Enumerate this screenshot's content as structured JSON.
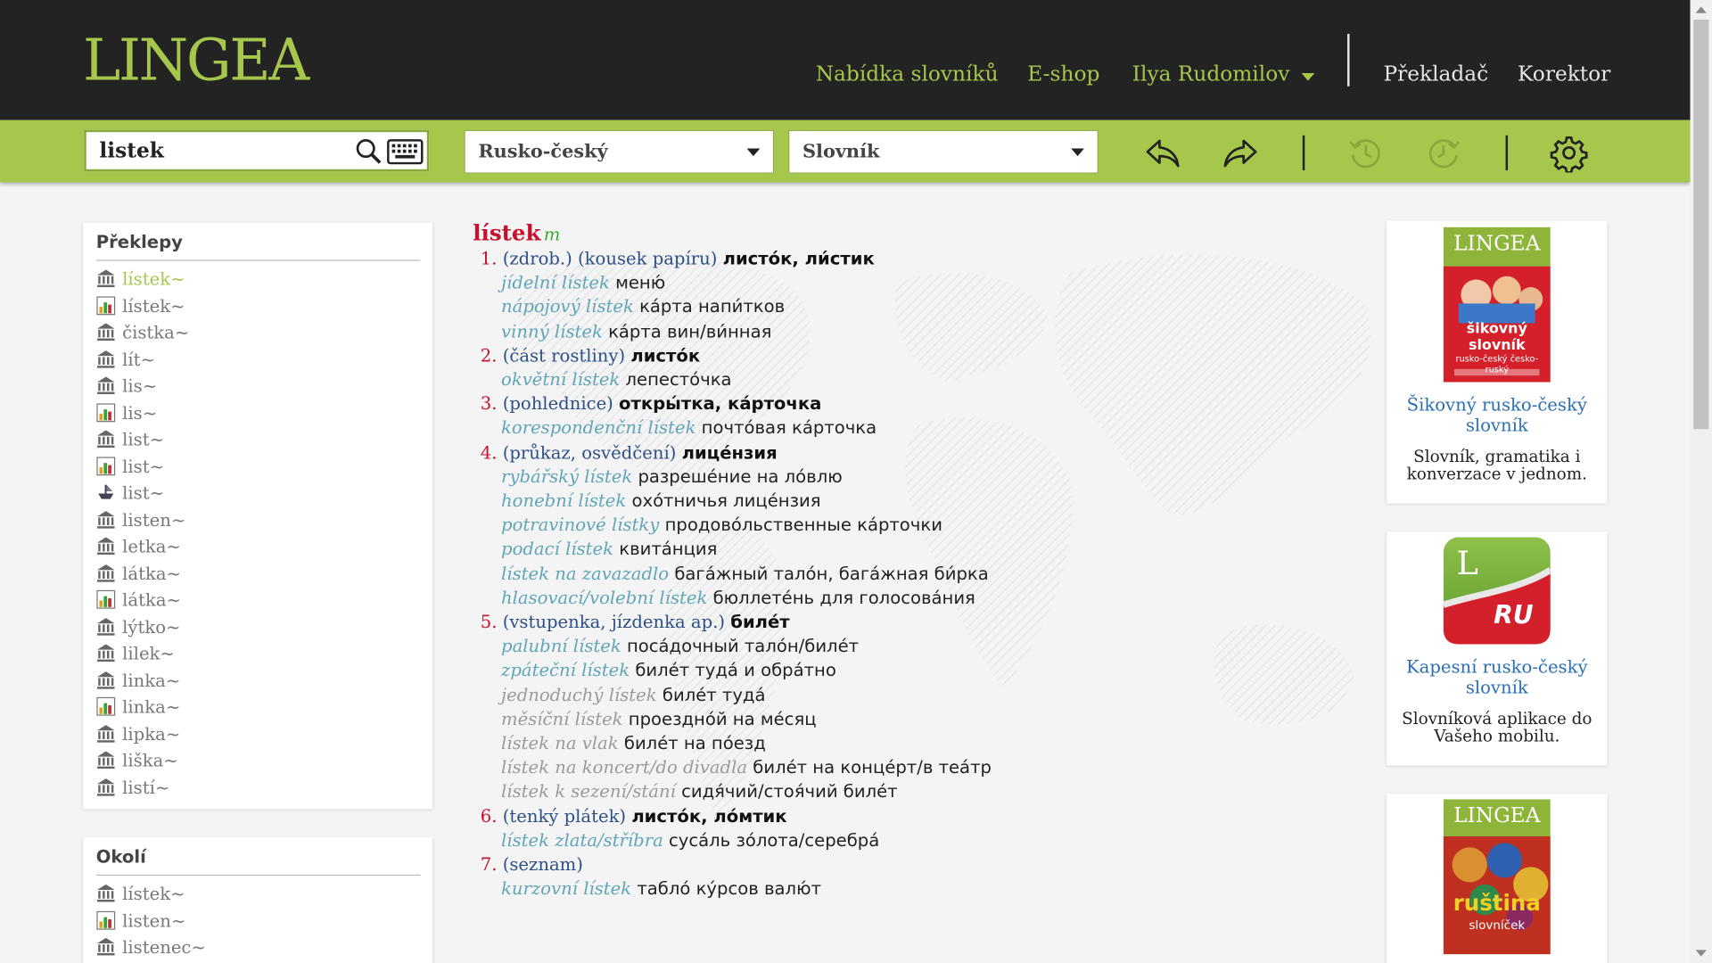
{
  "header": {
    "logo": "LINGEA",
    "nav": [
      "Nabídka slovníků",
      "E-shop"
    ],
    "user": "Ilya Rudomilov",
    "links": [
      "Překladač",
      "Korektor"
    ]
  },
  "toolbar": {
    "search_value": "listek",
    "direction": "Rusko-český",
    "mode": "Slovník",
    "icons": [
      "search-icon",
      "keyboard-icon",
      "back-icon",
      "forward-icon",
      "history-back-icon",
      "history-forward-icon",
      "gear-icon"
    ]
  },
  "sidebar": {
    "translations_title": "Překlepy",
    "translations": [
      {
        "word": "lístek~",
        "icon": "bank-icon",
        "active": true
      },
      {
        "word": "lístek~",
        "icon": "chart-icon"
      },
      {
        "word": "čistka~",
        "icon": "bank-icon"
      },
      {
        "word": "lít~",
        "icon": "bank-icon"
      },
      {
        "word": "lis~",
        "icon": "bank-icon"
      },
      {
        "word": "lis~",
        "icon": "chart-icon"
      },
      {
        "word": "list~",
        "icon": "bank-icon"
      },
      {
        "word": "list~",
        "icon": "chart-icon"
      },
      {
        "word": "list~",
        "icon": "ship-icon"
      },
      {
        "word": "listen~",
        "icon": "bank-icon"
      },
      {
        "word": "letka~",
        "icon": "bank-icon"
      },
      {
        "word": "látka~",
        "icon": "bank-icon"
      },
      {
        "word": "látka~",
        "icon": "chart-icon"
      },
      {
        "word": "lýtko~",
        "icon": "bank-icon"
      },
      {
        "word": "lilek~",
        "icon": "bank-icon"
      },
      {
        "word": "linka~",
        "icon": "bank-icon"
      },
      {
        "word": "linka~",
        "icon": "chart-icon"
      },
      {
        "word": "lipka~",
        "icon": "bank-icon"
      },
      {
        "word": "liška~",
        "icon": "bank-icon"
      },
      {
        "word": "listí~",
        "icon": "bank-icon"
      }
    ],
    "nearby_title": "Okolí",
    "nearby": [
      {
        "word": "lístek~",
        "icon": "bank-icon"
      },
      {
        "word": "listen~",
        "icon": "chart-icon"
      },
      {
        "word": "listenec~",
        "icon": "bank-icon"
      }
    ]
  },
  "entry": {
    "headword": "lístek",
    "pos": "m",
    "senses": [
      {
        "num": "1.",
        "gloss": "(zdrob.) (kousek papíru)",
        "trans": "листо́к, ли́стик",
        "examples": [
          {
            "cz": "jídelní lístek",
            "ru": "меню́"
          },
          {
            "cz": "nápojový lístek",
            "ru": "ка́рта напи́тков"
          },
          {
            "cz": "vinný lístek",
            "ru": "ка́рта вин/ви́нная"
          }
        ]
      },
      {
        "num": "2.",
        "gloss": "(část rostliny)",
        "trans": "листо́к",
        "examples": [
          {
            "cz": "okvětní lístek",
            "ru": "лепесто́чка"
          }
        ]
      },
      {
        "num": "3.",
        "gloss": "(pohlednice)",
        "trans": "откры́тка, ка́рточка",
        "examples": [
          {
            "cz": "korespondenční lístek",
            "ru": "почто́вая ка́рточка"
          }
        ]
      },
      {
        "num": "4.",
        "gloss": "(průkaz, osvědčení)",
        "trans": "лице́нзия",
        "examples": [
          {
            "cz": "rybářský lístek",
            "ru": "разреше́ние на ло́влю"
          },
          {
            "cz": "honební lístek",
            "ru": "охо́тничья лице́нзия"
          },
          {
            "cz": "potravinové lístky",
            "ru": "продово́льственные ка́рточки"
          },
          {
            "cz": "podací lístek",
            "ru": "квита́нция"
          },
          {
            "cz": "lístek na zavazadlo",
            "ru": "бага́жный тало́н, бага́жная би́рка"
          },
          {
            "cz": "hlasovací/volební lístek",
            "ru": "бюллете́нь для голосова́ния"
          }
        ]
      },
      {
        "num": "5.",
        "gloss": "(vstupenka, jízdenka ap.)",
        "trans": "биле́т",
        "examples": [
          {
            "cz": "palubní lístek",
            "ru": "поса́дочный тало́н/биле́т"
          },
          {
            "cz": "zpáteční lístek",
            "ru": "биле́т туда́ и обра́тно"
          },
          {
            "cz": "jednoduchý lístek",
            "ru": "биле́т туда́"
          },
          {
            "cz": "měsíční lístek",
            "ru": "проездно́й на ме́сяц"
          },
          {
            "cz": "lístek na vlak",
            "ru": "биле́т на по́езд"
          },
          {
            "cz": "lístek na koncert/do divadla",
            "ru": "биле́т на конце́рт/в теа́тр"
          },
          {
            "cz": "lístek k sezení/stání",
            "ru": "сидя́чий/стоя́чий биле́т"
          }
        ]
      },
      {
        "num": "6.",
        "gloss": "(tenký plátek)",
        "trans": "листо́к, ло́мтик",
        "examples": [
          {
            "cz": "lístek zlata/stříbra",
            "ru": "суса́ль зо́лота/серебра́"
          }
        ]
      },
      {
        "num": "7.",
        "gloss": "(seznam)",
        "trans": "",
        "examples": [
          {
            "cz": "kurzovní lístek",
            "ru": "табло́ ку́рсов валю́т"
          }
        ]
      }
    ]
  },
  "ads": [
    {
      "cover_brand": "LINGEA",
      "cover_title": "šikovný slovník",
      "cover_sub": "rusko-český česko-ruský",
      "title": "Šikovný rusko-český slovník",
      "desc": "Slovník, gramatika i konverzace v jednom."
    },
    {
      "app_letter": "L",
      "app_code": "RU",
      "title": "Kapesní rusko-český slovník",
      "desc": "Slovníková aplikace do Vašeho mobilu."
    },
    {
      "cover_brand": "LINGEA",
      "cover_title": "ruština",
      "cover_sub": "slovníček"
    }
  ],
  "colors": {
    "accent": "#a6c64c",
    "header_bg": "#232323",
    "headword": "#c8102e",
    "gloss": "#2b4f86",
    "example": "#5fa4b8",
    "link": "#2b6fb0"
  }
}
